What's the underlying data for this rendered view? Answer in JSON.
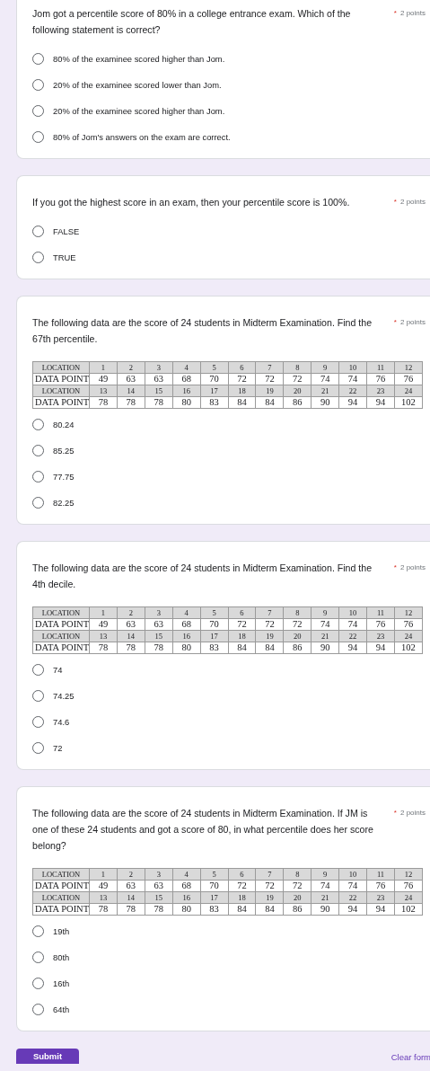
{
  "questions": [
    {
      "text": "Jom got a percentile score of 80% in a college entrance exam. Which of the following statement is correct?",
      "required_mark": "*",
      "points": "2 points",
      "options": [
        {
          "label": "80% of the examinee scored higher than Jom.",
          "selected": false
        },
        {
          "label": "20% of the examinee scored lower than Jom.",
          "selected": false
        },
        {
          "label": "20% of the examinee scored higher than Jom.",
          "selected": false
        },
        {
          "label": "80% of Jom's answers on the exam are correct.",
          "selected": false
        }
      ]
    },
    {
      "text": "If you got the highest score in an exam, then your percentile score is 100%.",
      "required_mark": "*",
      "points": "2 points",
      "options": [
        {
          "label": "FALSE",
          "selected": false
        },
        {
          "label": "TRUE",
          "selected": false
        }
      ]
    },
    {
      "text": "The following data are the score of 24 students in Midterm Examination. Find the 67th percentile.",
      "required_mark": "*",
      "points": "2 points",
      "table": [
        {
          "kind": "location",
          "label": "LOCATION",
          "cells": [
            "1",
            "2",
            "3",
            "4",
            "5",
            "6",
            "7",
            "8",
            "9",
            "10",
            "11",
            "12"
          ]
        },
        {
          "kind": "data",
          "label": "DATA POINT",
          "cells": [
            "49",
            "63",
            "63",
            "68",
            "70",
            "72",
            "72",
            "72",
            "74",
            "74",
            "76",
            "76"
          ]
        },
        {
          "kind": "location",
          "label": "LOCATION",
          "cells": [
            "13",
            "14",
            "15",
            "16",
            "17",
            "18",
            "19",
            "20",
            "21",
            "22",
            "23",
            "24"
          ]
        },
        {
          "kind": "data",
          "label": "DATA POINT",
          "cells": [
            "78",
            "78",
            "78",
            "80",
            "83",
            "84",
            "84",
            "86",
            "90",
            "94",
            "94",
            "102"
          ]
        }
      ],
      "options": [
        {
          "label": "80.24",
          "selected": false
        },
        {
          "label": "85.25",
          "selected": false
        },
        {
          "label": "77.75",
          "selected": false
        },
        {
          "label": "82.25",
          "selected": false
        }
      ]
    },
    {
      "text": "The following data are the score of 24 students in Midterm Examination. Find the 4th decile.",
      "required_mark": "*",
      "points": "2 points",
      "table": [
        {
          "kind": "location",
          "label": "LOCATION",
          "cells": [
            "1",
            "2",
            "3",
            "4",
            "5",
            "6",
            "7",
            "8",
            "9",
            "10",
            "11",
            "12"
          ]
        },
        {
          "kind": "data",
          "label": "DATA POINT",
          "cells": [
            "49",
            "63",
            "63",
            "68",
            "70",
            "72",
            "72",
            "72",
            "74",
            "74",
            "76",
            "76"
          ]
        },
        {
          "kind": "location",
          "label": "LOCATION",
          "cells": [
            "13",
            "14",
            "15",
            "16",
            "17",
            "18",
            "19",
            "20",
            "21",
            "22",
            "23",
            "24"
          ]
        },
        {
          "kind": "data",
          "label": "DATA POINT",
          "cells": [
            "78",
            "78",
            "78",
            "80",
            "83",
            "84",
            "84",
            "86",
            "90",
            "94",
            "94",
            "102"
          ]
        }
      ],
      "options": [
        {
          "label": "74",
          "selected": false
        },
        {
          "label": "74.25",
          "selected": false
        },
        {
          "label": "74.6",
          "selected": false
        },
        {
          "label": "72",
          "selected": false
        }
      ]
    },
    {
      "text": "The following data are the score of 24 students in Midterm Examination. If JM is one of these 24 students and got a score of 80, in what percentile does her score belong?",
      "required_mark": "*",
      "points": "2 points",
      "table": [
        {
          "kind": "location",
          "label": "LOCATION",
          "cells": [
            "1",
            "2",
            "3",
            "4",
            "5",
            "6",
            "7",
            "8",
            "9",
            "10",
            "11",
            "12"
          ]
        },
        {
          "kind": "data",
          "label": "DATA POINT",
          "cells": [
            "49",
            "63",
            "63",
            "68",
            "70",
            "72",
            "72",
            "72",
            "74",
            "74",
            "76",
            "76"
          ]
        },
        {
          "kind": "location",
          "label": "LOCATION",
          "cells": [
            "13",
            "14",
            "15",
            "16",
            "17",
            "18",
            "19",
            "20",
            "21",
            "22",
            "23",
            "24"
          ]
        },
        {
          "kind": "data",
          "label": "DATA POINT",
          "cells": [
            "78",
            "78",
            "78",
            "80",
            "83",
            "84",
            "84",
            "86",
            "90",
            "94",
            "94",
            "102"
          ]
        }
      ],
      "options": [
        {
          "label": "19th",
          "selected": false
        },
        {
          "label": "80th",
          "selected": false
        },
        {
          "label": "16th",
          "selected": false
        },
        {
          "label": "64th",
          "selected": false
        }
      ]
    }
  ],
  "footer": {
    "submit": "Submit",
    "clear": "Clear form"
  }
}
